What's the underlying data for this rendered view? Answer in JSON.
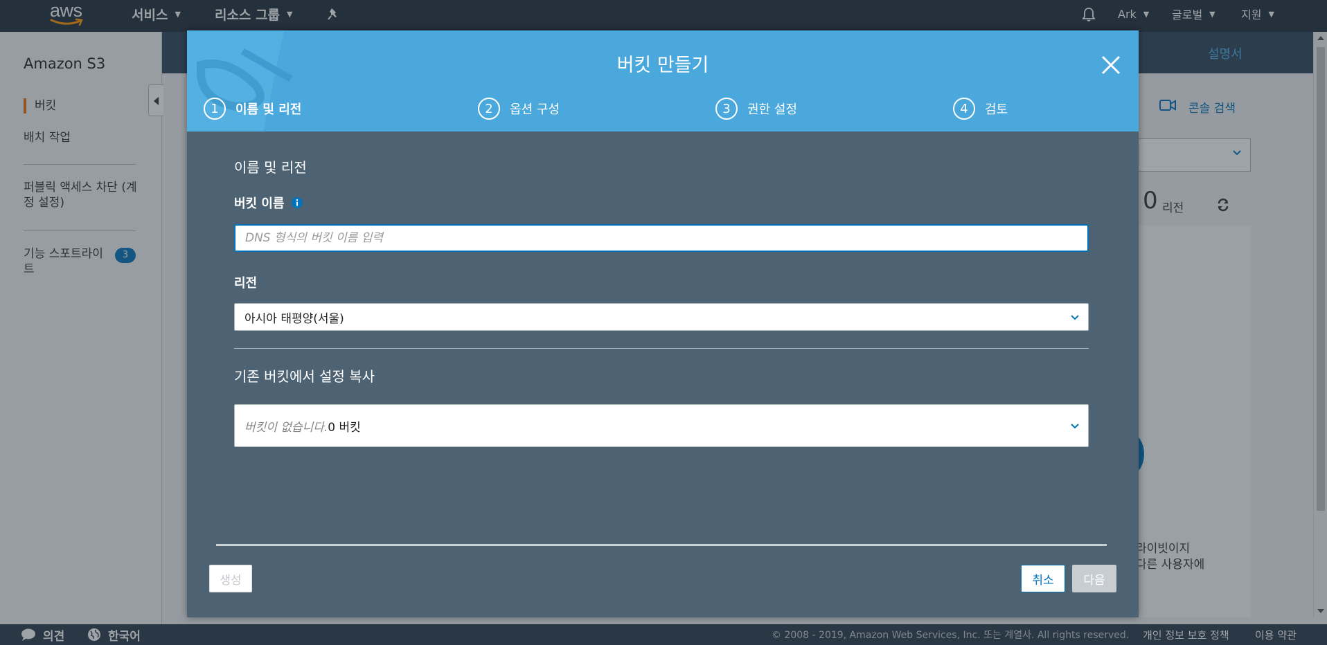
{
  "topnav": {
    "logo": "aws",
    "services": "서비스",
    "resource_groups": "리소스 그룹",
    "user": "Ark",
    "region": "글로벌",
    "support": "지원",
    "icons": [
      "pin-icon",
      "bell-icon",
      "chevron-down-icon"
    ]
  },
  "sidebar": {
    "title": "Amazon S3",
    "items": [
      {
        "label": "버킷",
        "active": true
      },
      {
        "label": "배치 작업"
      },
      {
        "label": "퍼블릭 액세스 차단 (계정 설정)"
      },
      {
        "label": "기능 스포트라이트",
        "badge": "3"
      }
    ]
  },
  "page": {
    "docs_link": "설명서",
    "console_search": "콘솔 검색",
    "region_count": "0",
    "region_label": "리전",
    "card_text_1": "라이빗이지",
    "card_text_2": "다른 사용자에"
  },
  "modal": {
    "title": "버킷 만들기",
    "steps": [
      {
        "num": "1",
        "label": "이름 및 리전",
        "active": true
      },
      {
        "num": "2",
        "label": "옵션 구성"
      },
      {
        "num": "3",
        "label": "권한 설정"
      },
      {
        "num": "4",
        "label": "검토"
      }
    ],
    "section_name_region": "이름 및 리전",
    "bucket_name_label": "버킷 이름",
    "bucket_name_placeholder": "DNS 형식의 버킷 이름 입력",
    "bucket_name_value": "",
    "region_label": "리전",
    "region_value": "아시아 태평양(서울)",
    "copy_section": "기존 버킷에서 설정 복사",
    "copy_placeholder": "버킷이 없습니다.",
    "copy_count": "0 버킷",
    "buttons": {
      "create": "생성",
      "cancel": "취소",
      "next": "다음"
    }
  },
  "footer": {
    "feedback": "의견",
    "language": "한국어",
    "copyright": "© 2008 - 2019, Amazon Web Services, Inc. 또는 계열사. All rights reserved.",
    "privacy": "개인 정보 보호 정책",
    "terms": "이용 약관"
  },
  "colors": {
    "nav_bg": "#232f3e",
    "modal_header": "#4aa8dd",
    "modal_body": "#4d6373",
    "primary": "#0073bb",
    "accent": "#ec7211"
  }
}
